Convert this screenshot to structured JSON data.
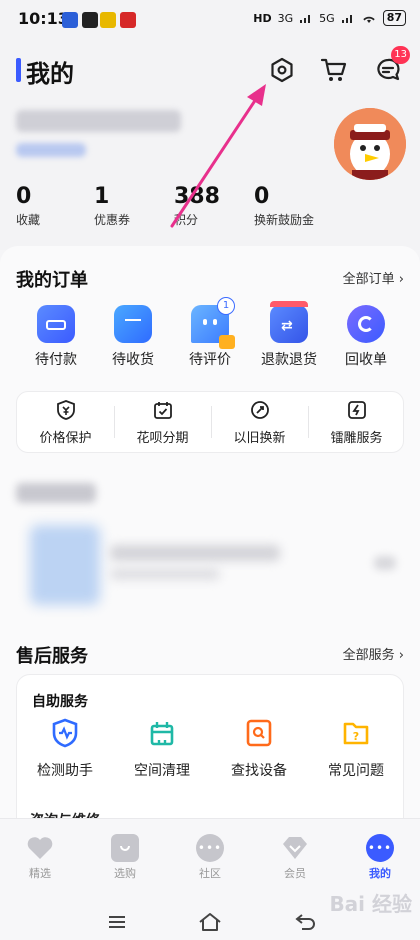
{
  "status_bar": {
    "time": "10:13",
    "network_1": "HD",
    "network_2": "3G",
    "network_3": "5G",
    "battery": "87"
  },
  "header": {
    "title": "我的",
    "message_badge": "13",
    "icons": [
      "settings-icon",
      "cart-icon",
      "message-icon"
    ],
    "accent_color": "#3b5bff"
  },
  "stats": [
    {
      "value": "0",
      "label": "收藏"
    },
    {
      "value": "1",
      "label": "优惠券"
    },
    {
      "value": "388",
      "label": "积分"
    },
    {
      "value": "0",
      "label": "换新鼓励金"
    }
  ],
  "orders": {
    "title": "我的订单",
    "link": "全部订单 ›",
    "items": [
      {
        "label": "待付款",
        "icon": "wallet-icon"
      },
      {
        "label": "待收货",
        "icon": "package-icon"
      },
      {
        "label": "待评价",
        "icon": "comment-icon",
        "badge": "1"
      },
      {
        "label": "退款退货",
        "icon": "refund-icon"
      },
      {
        "label": "回收单",
        "icon": "recycle-icon"
      }
    ]
  },
  "services": [
    {
      "label": "价格保护",
      "icon": "price-protect-icon"
    },
    {
      "label": "花呗分期",
      "icon": "calendar-check-icon"
    },
    {
      "label": "以旧换新",
      "icon": "trade-in-icon"
    },
    {
      "label": "镭雕服务",
      "icon": "laser-engrave-icon"
    }
  ],
  "after_sales": {
    "title": "售后服务",
    "link": "全部服务 ›",
    "self_service_title": "自助服务",
    "items": [
      {
        "label": "检测助手",
        "icon": "shield-check-icon"
      },
      {
        "label": "空间清理",
        "icon": "clean-icon"
      },
      {
        "label": "查找设备",
        "icon": "find-device-icon"
      },
      {
        "label": "常见问题",
        "icon": "question-icon"
      }
    ],
    "next_section_title": "咨询与维修"
  },
  "bottom_nav": [
    {
      "label": "精选",
      "icon": "heart-icon"
    },
    {
      "label": "选购",
      "icon": "bag-icon"
    },
    {
      "label": "社区",
      "icon": "chat-icon"
    },
    {
      "label": "会员",
      "icon": "diamond-icon"
    },
    {
      "label": "我的",
      "icon": "profile-icon",
      "active": true
    }
  ],
  "watermark": "Bai 经验",
  "colors": {
    "primary": "#3b5bff",
    "badge": "#ff3355",
    "arrow": "#e8308c"
  }
}
